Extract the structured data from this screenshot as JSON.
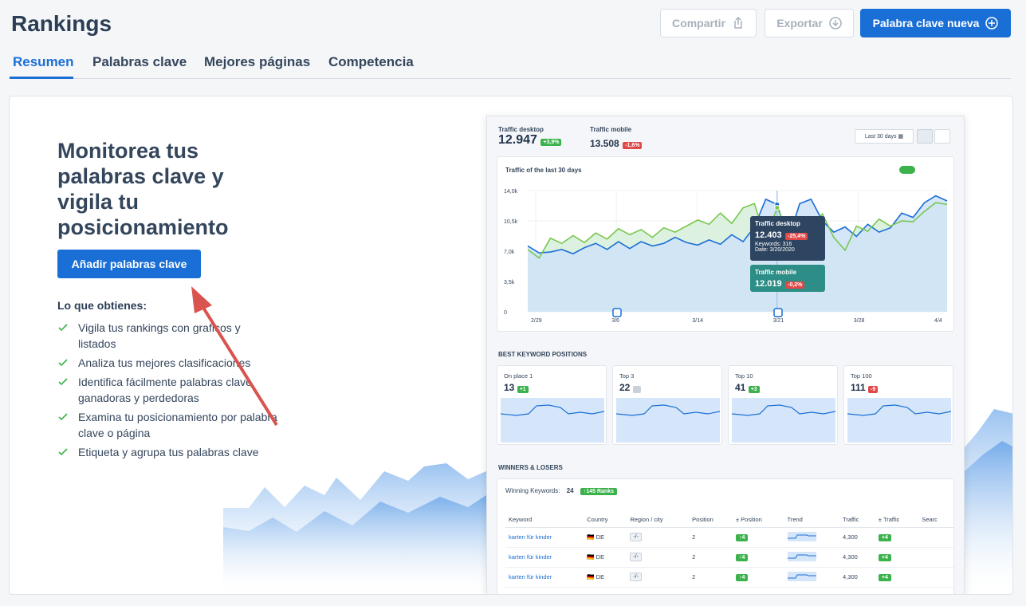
{
  "header": {
    "title": "Rankings",
    "share_label": "Compartir",
    "export_label": "Exportar",
    "new_keyword_label": "Palabra clave nueva"
  },
  "tabs": [
    {
      "label": "Resumen",
      "active": true
    },
    {
      "label": "Palabras clave",
      "active": false
    },
    {
      "label": "Mejores páginas",
      "active": false
    },
    {
      "label": "Competencia",
      "active": false
    }
  ],
  "hero": {
    "title": "Monitorea tus palabras clave y vigila tu posicionamiento",
    "cta_label": "Añadir palabras clave",
    "benefits_title": "Lo que obtienes:",
    "benefits": [
      "Vigila tus rankings con graficos y listados",
      "Analiza tus mejores clasificaciones",
      "Identifica fácilmente palabras clave ganadoras y perdedoras",
      "Examina tu posicionamiento por palabra clave o página",
      "Etiqueta y agrupa tus palabras clave"
    ]
  },
  "preview": {
    "traffic_desktop_label": "Traffic desktop",
    "traffic_desktop_value": "12.947",
    "traffic_desktop_change": "+3,9%",
    "traffic_mobile_label": "Traffic mobile",
    "traffic_mobile_value": "13.508",
    "traffic_mobile_change": "-1,6%",
    "date_range": "Last 30 days",
    "chart_title": "Traffic of the last 30 days",
    "tooltip_desktop": {
      "label": "Traffic desktop",
      "value": "12.403",
      "change": "-25,4%",
      "keywords": "Keywords: 316",
      "date": "Date: 3/20/2020"
    },
    "tooltip_mobile": {
      "label": "Traffic mobile",
      "value": "12.019",
      "change": "-0,2%"
    },
    "best_positions_title": "BEST KEYWORD POSITIONS",
    "positions": [
      {
        "label": "On place 1",
        "value": "13",
        "change": "+1",
        "type": "green"
      },
      {
        "label": "Top 3",
        "value": "22",
        "change": "0",
        "type": "gray"
      },
      {
        "label": "Top 10",
        "value": "41",
        "change": "+3",
        "type": "green"
      },
      {
        "label": "Top 100",
        "value": "111",
        "change": "-9",
        "type": "red"
      }
    ],
    "winners_title": "WINNERS & LOSERS",
    "winning_label": "Winning Keywords:",
    "winning_count": "24",
    "winning_ranks": "↑145 Ranks",
    "table_headers": [
      "Keyword",
      "Country",
      "Region / city",
      "Position",
      "± Position",
      "Trend",
      "Traffic",
      "± Traffic",
      "Searc"
    ],
    "rows": [
      {
        "keyword": "karten für kinder",
        "country": "DE",
        "region": "-/-",
        "position": "2",
        "pos_change": "↑4",
        "traffic": "4,300",
        "traffic_change": "+4"
      },
      {
        "keyword": "karten für kinder",
        "country": "DE",
        "region": "-/-",
        "position": "2",
        "pos_change": "↑4",
        "traffic": "4,300",
        "traffic_change": "+4"
      },
      {
        "keyword": "karten für kinder",
        "country": "DE",
        "region": "-/-",
        "position": "2",
        "pos_change": "↑4",
        "traffic": "4,300",
        "traffic_change": "+4"
      }
    ]
  },
  "chart_data": {
    "type": "area",
    "title": "Traffic of the last 30 days",
    "x": [
      "2/29",
      "3/6",
      "3/14",
      "3/21",
      "3/28",
      "4/4"
    ],
    "ylabel": "",
    "y_ticks": [
      "0",
      "3,5k",
      "7,0k",
      "10,5k",
      "14,0k"
    ],
    "ylim": [
      0,
      14000
    ],
    "series": [
      {
        "name": "Traffic desktop",
        "color": "#1a6fd6",
        "values": [
          7600,
          6800,
          6900,
          7200,
          6700,
          7400,
          7900,
          7200,
          8100,
          7300,
          8100,
          7600,
          7900,
          8600,
          8000,
          7700,
          8300,
          7800,
          8900,
          8100,
          9800,
          13000,
          12403,
          8400,
          12500,
          13000,
          10500,
          9200,
          9800,
          8700,
          10100,
          9200,
          9700,
          11400,
          10900,
          12600,
          13400,
          12800
        ]
      },
      {
        "name": "Traffic mobile",
        "color": "#7ac74f",
        "values": [
          7200,
          6200,
          8500,
          7900,
          8800,
          8000,
          9100,
          8400,
          9600,
          8900,
          9500,
          8600,
          9700,
          9200,
          9900,
          10600,
          10100,
          11400,
          10200,
          12000,
          12500,
          8300,
          12019,
          9300,
          9500,
          9800,
          11300,
          8600,
          7100,
          9900,
          9300,
          10700,
          9900,
          10500,
          10400,
          11600,
          12600,
          12400
        ]
      }
    ]
  },
  "colors": {
    "accent": "#1a6fd6",
    "arrow": "#d9534f",
    "check": "#3bb24b"
  }
}
